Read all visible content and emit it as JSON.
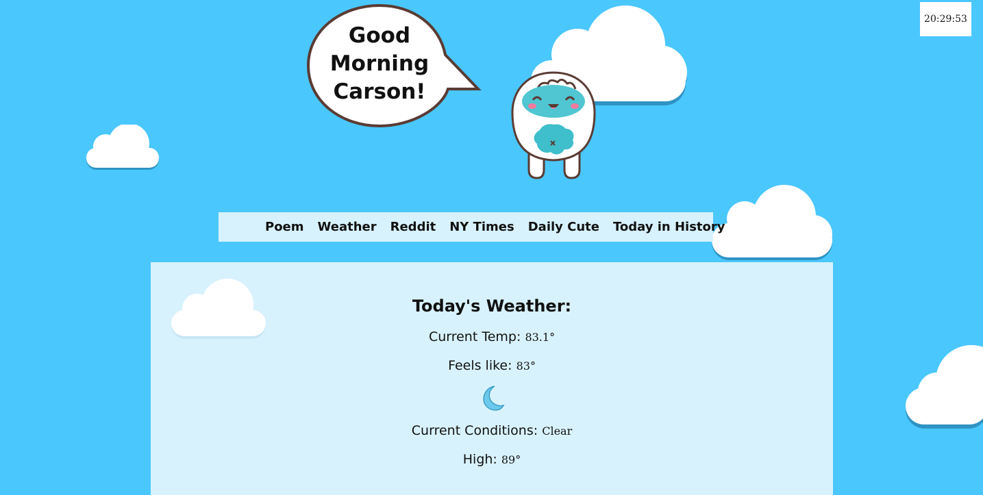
{
  "clock": {
    "time": "20:29:53"
  },
  "greeting": {
    "line1": "Good",
    "line2": "Morning",
    "line3": "Carson!"
  },
  "nav": {
    "items": [
      "Poem",
      "Weather",
      "Reddit",
      "NY Times",
      "Daily Cute",
      "Today in History"
    ]
  },
  "weather": {
    "heading": "Today's Weather:",
    "current_temp_label": "Current Temp:",
    "current_temp_value": "83.1°",
    "feels_like_label": "Feels like:",
    "feels_like_value": "83°",
    "condition_icon": "crescent-moon-icon",
    "conditions_label": "Current Conditions:",
    "conditions_value": "Clear",
    "high_label": "High:",
    "high_value": "89°"
  },
  "colors": {
    "sky": "#4ac7fd",
    "panel": "#d8f2fd",
    "cloud": "#ffffff",
    "cloud_shadow": "#2f93c4",
    "bubble_border": "#5a3b33",
    "mascot_face": "#4fc6d1",
    "moon": "#6cc8ec"
  }
}
